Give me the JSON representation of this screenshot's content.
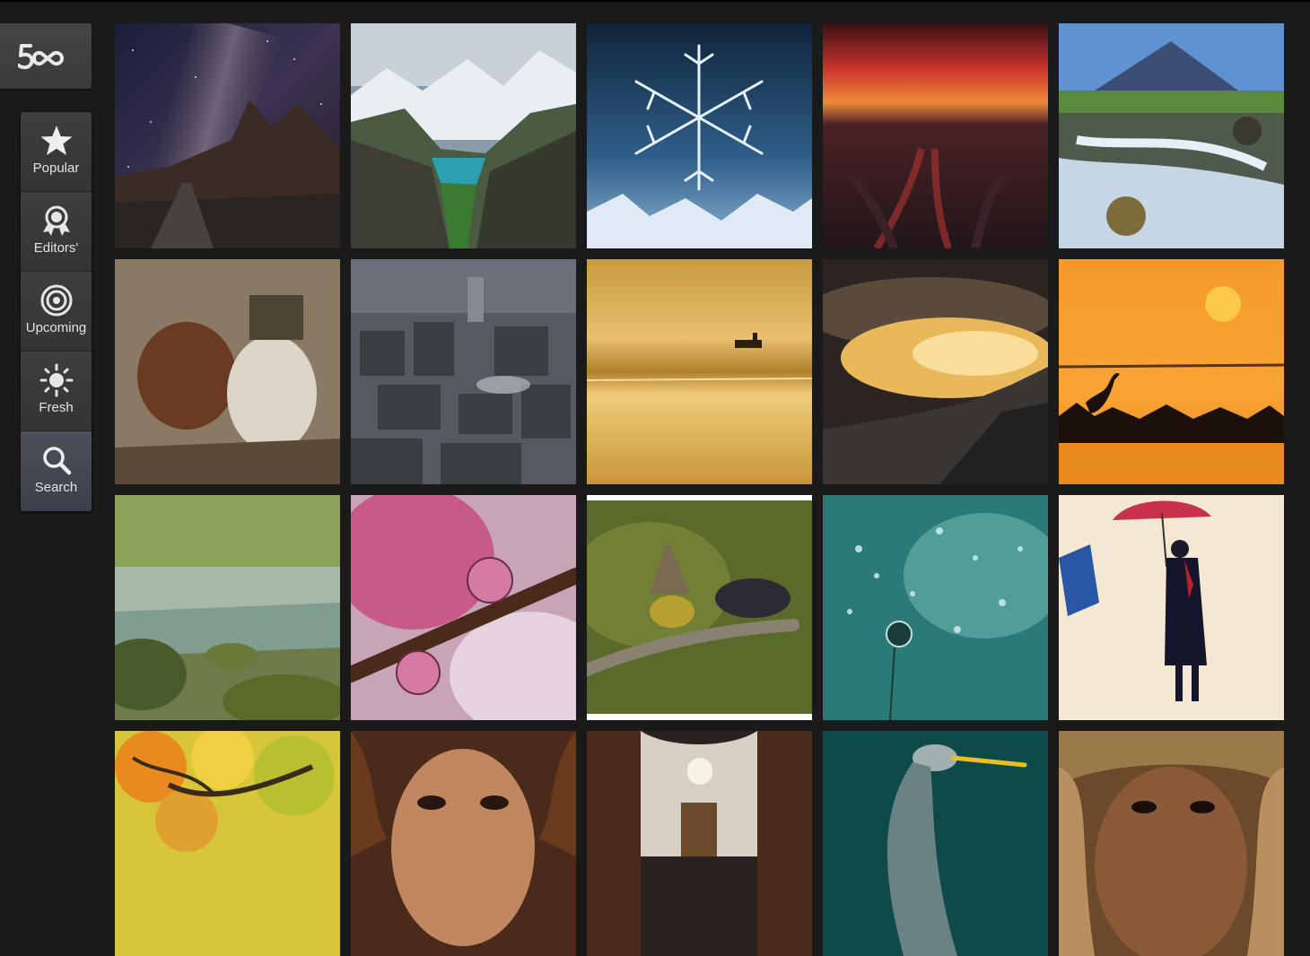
{
  "app": {
    "logo_text": "500"
  },
  "nav": {
    "items": [
      {
        "label": "Popular",
        "icon": "star-icon"
      },
      {
        "label": "Editors'",
        "icon": "award-icon"
      },
      {
        "label": "Upcoming",
        "icon": "target-icon"
      },
      {
        "label": "Fresh",
        "icon": "sun-icon"
      },
      {
        "label": "Search",
        "icon": "search-icon",
        "active": true
      }
    ]
  },
  "colors": {
    "background": "#1a1a1a",
    "nav_item": "#3a3a3a",
    "nav_active": "#454b55",
    "nav_text": "#e3e3e3"
  },
  "photos": [
    {
      "subject": "milky-way-road"
    },
    {
      "subject": "mountain-lake-valley"
    },
    {
      "subject": "snowflake"
    },
    {
      "subject": "red-sunset-tracks"
    },
    {
      "subject": "volcano-waterfall"
    },
    {
      "subject": "bull-race"
    },
    {
      "subject": "old-village"
    },
    {
      "subject": "golden-boat"
    },
    {
      "subject": "golden-clouds"
    },
    {
      "subject": "heron-sunset"
    },
    {
      "subject": "forest-stream"
    },
    {
      "subject": "rose-droplet"
    },
    {
      "subject": "birds-feeding"
    },
    {
      "subject": "dandelion-drops"
    },
    {
      "subject": "umbrella-girl"
    },
    {
      "subject": "autumn-tree"
    },
    {
      "subject": "curly-hair-portrait"
    },
    {
      "subject": "church-interior"
    },
    {
      "subject": "heron-head"
    },
    {
      "subject": "scarf-portrait"
    }
  ]
}
